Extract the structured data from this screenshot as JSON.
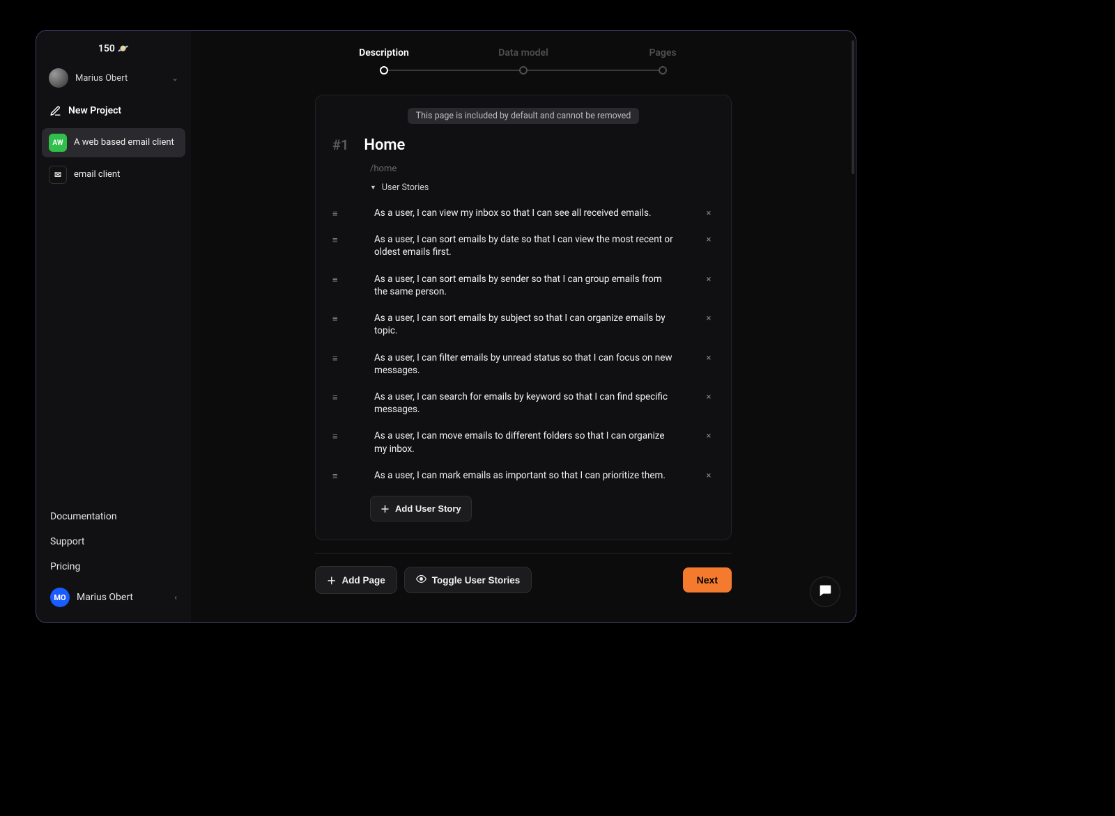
{
  "credits": {
    "amount": "150",
    "icon": "🪐"
  },
  "user": {
    "name": "Marius Obert"
  },
  "sidebar": {
    "new_project_label": "New Project",
    "projects": [
      {
        "badge": "AW",
        "label": "A web based email client",
        "active": true,
        "badge_style": "green"
      },
      {
        "badge": "✉",
        "label": "email client",
        "active": false,
        "badge_style": "dark"
      }
    ],
    "links": [
      {
        "label": "Documentation"
      },
      {
        "label": "Support"
      },
      {
        "label": "Pricing"
      }
    ],
    "account": {
      "initials": "MO",
      "name": "Marius Obert"
    }
  },
  "stepper": {
    "steps": [
      {
        "label": "Description",
        "active": true
      },
      {
        "label": "Data model",
        "active": false
      },
      {
        "label": "Pages",
        "active": false
      }
    ]
  },
  "page": {
    "default_notice": "This page is included by default and cannot be removed",
    "number": "#1",
    "title": "Home",
    "path": "/home",
    "stories_header": "User Stories",
    "stories": [
      "As a user, I can view my inbox so that I can see all received emails.",
      "As a user, I can sort emails by date so that I can view the most recent or oldest emails first.",
      "As a user, I can sort emails by sender so that I can group emails from the same person.",
      "As a user, I can sort emails by subject so that I can organize emails by topic.",
      "As a user, I can filter emails by unread status so that I can focus on new messages.",
      "As a user, I can search for emails by keyword so that I can find specific messages.",
      "As a user, I can move emails to different folders so that I can organize my inbox.",
      "As a user, I can mark emails as important so that I can prioritize them."
    ],
    "add_story_label": "Add User Story"
  },
  "bottom": {
    "add_page_label": "Add Page",
    "toggle_stories_label": "Toggle User Stories",
    "next_label": "Next"
  }
}
